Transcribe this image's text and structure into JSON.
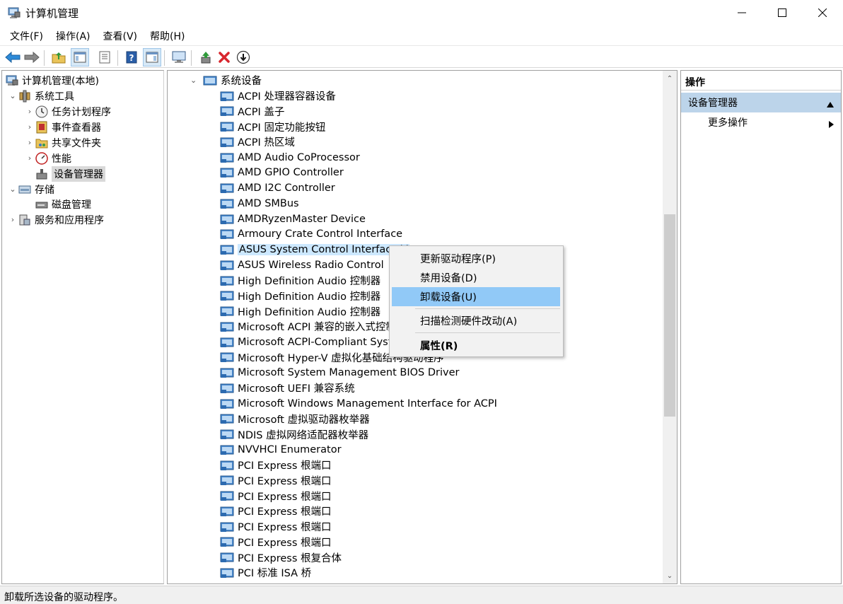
{
  "window": {
    "title": "计算机管理",
    "controls": {
      "minimize_icon": "minimize-icon",
      "maximize_icon": "maximize-icon",
      "close_icon": "close-icon"
    }
  },
  "menubar": {
    "items": [
      "文件(F)",
      "操作(A)",
      "查看(V)",
      "帮助(H)"
    ]
  },
  "toolbar": {
    "icons": [
      "back-arrow-icon",
      "forward-arrow-icon",
      "up-folder-icon",
      "show-hide-tree-icon",
      "properties-icon",
      "help-icon",
      "show-action-pane-icon",
      "monitor-icon",
      "update-driver-icon",
      "uninstall-x-icon",
      "disable-device-icon"
    ]
  },
  "tree": {
    "root": "计算机管理(本地)",
    "system_tools": "系统工具",
    "task_scheduler": "任务计划程序",
    "event_viewer": "事件查看器",
    "shared_folders": "共享文件夹",
    "performance": "性能",
    "device_manager": "设备管理器",
    "storage": "存储",
    "disk_management": "磁盘管理",
    "services_apps": "服务和应用程序"
  },
  "devices": {
    "category": "系统设备",
    "items": [
      "ACPI 处理器容器设备",
      "ACPI 盖子",
      "ACPI 固定功能按钮",
      "ACPI 热区域",
      "AMD Audio CoProcessor",
      "AMD GPIO Controller",
      "AMD I2C Controller",
      "AMD SMBus",
      "AMDRyzenMaster Device",
      "Armoury Crate Control Interface",
      "ASUS System Control Interface V",
      "ASUS Wireless Radio Control",
      "High Definition Audio 控制器",
      "High Definition Audio 控制器",
      "High Definition Audio 控制器",
      "Microsoft ACPI 兼容的嵌入式控制",
      "Microsoft ACPI-Compliant Syster",
      "Microsoft Hyper-V 虚拟化基础结构驱动程序",
      "Microsoft System Management BIOS Driver",
      "Microsoft UEFI 兼容系统",
      "Microsoft Windows Management Interface for ACPI",
      "Microsoft 虚拟驱动器枚举器",
      "NDIS 虚拟网络适配器枚举器",
      "NVVHCI Enumerator",
      "PCI Express 根端口",
      "PCI Express 根端口",
      "PCI Express 根端口",
      "PCI Express 根端口",
      "PCI Express 根端口",
      "PCI Express 根端口",
      "PCI Express 根复合体",
      "PCI 标准 ISA 桥"
    ],
    "selected_index": 10
  },
  "context_menu": {
    "update_driver": "更新驱动程序(P)",
    "disable_device": "禁用设备(D)",
    "uninstall_device": "卸载设备(U)",
    "scan_hardware": "扫描检测硬件改动(A)",
    "properties": "属性(R)"
  },
  "actions": {
    "header": "操作",
    "group": "设备管理器",
    "more": "更多操作"
  },
  "statusbar": {
    "text": "卸载所选设备的驱动程序。"
  },
  "colors": {
    "selection": "#cce8ff",
    "menu_highlight": "#91c9f7",
    "actions_group": "#bcd4ea"
  }
}
